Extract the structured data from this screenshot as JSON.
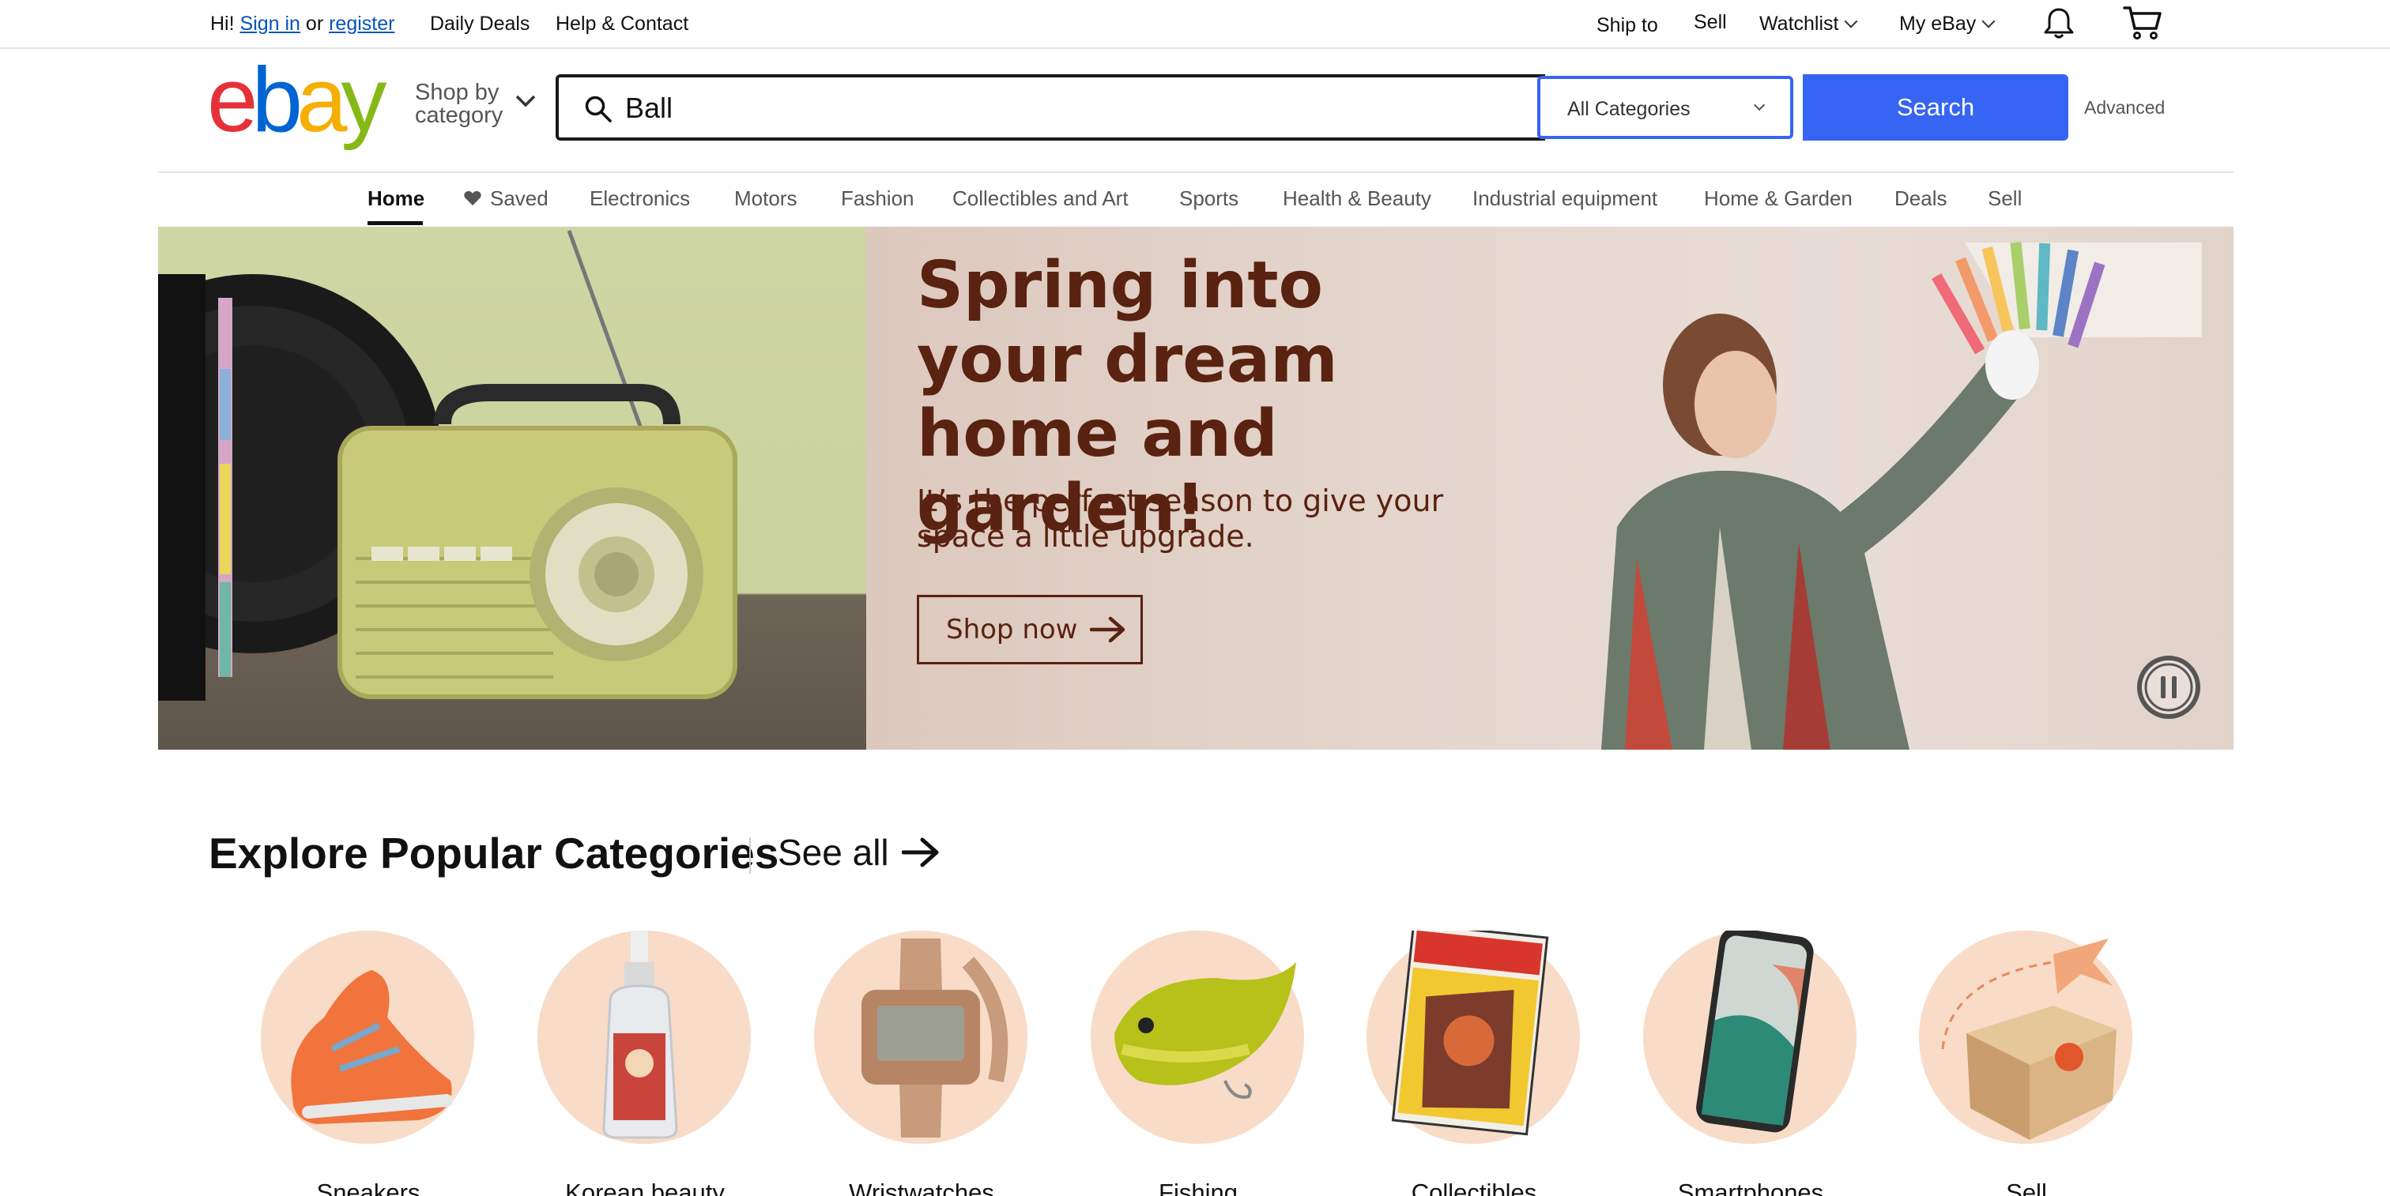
{
  "topbar": {
    "greeting": "Hi!",
    "sign_in": "Sign in",
    "or": "or",
    "register": "register",
    "daily_deals": "Daily Deals",
    "help_contact": "Help & Contact",
    "ship_to": "Ship to",
    "sell": "Sell",
    "watchlist": "Watchlist",
    "my_ebay": "My eBay",
    "icons": [
      "bell-icon",
      "cart-icon"
    ]
  },
  "header": {
    "logo_text": "ebay",
    "logo_colors": [
      "#e53238",
      "#0064d2",
      "#f5af02",
      "#86b817"
    ],
    "shop_by_category": "Shop by\ncategory",
    "search": {
      "value": "Ball"
    },
    "category_select": "All Categories",
    "search_button": "Search",
    "advanced": "Advanced",
    "accent_color": "#3665f3"
  },
  "nav": {
    "items": [
      {
        "label": "Home",
        "active": true
      },
      {
        "label": "Saved",
        "icon": "heart-icon"
      },
      {
        "label": "Electronics"
      },
      {
        "label": "Motors"
      },
      {
        "label": "Fashion"
      },
      {
        "label": "Collectibles and Art"
      },
      {
        "label": "Sports"
      },
      {
        "label": "Health & Beauty"
      },
      {
        "label": "Industrial equipment"
      },
      {
        "label": "Home & Garden"
      },
      {
        "label": "Deals"
      },
      {
        "label": "Sell"
      }
    ]
  },
  "hero": {
    "title": "Spring into your dream home and garden!",
    "subtitle": "It’s the perfect season to give your space a little upgrade.",
    "cta": "Shop now",
    "text_color": "#5a2210",
    "pause_icon": "pause-icon"
  },
  "categories": {
    "title": "Explore Popular Categories",
    "see_all": "See all",
    "items": [
      {
        "label": "Sneakers",
        "icon": "sneaker-icon"
      },
      {
        "label": "Korean beauty",
        "icon": "serum-bottle-icon"
      },
      {
        "label": "Wristwatches",
        "icon": "wristwatch-icon"
      },
      {
        "label": "Fishing",
        "icon": "fishing-lure-icon"
      },
      {
        "label": "Collectibles",
        "icon": "comic-book-icon"
      },
      {
        "label": "Smartphones",
        "icon": "smartphone-icon"
      },
      {
        "label": "Sell",
        "icon": "shipping-box-icon"
      }
    ]
  }
}
